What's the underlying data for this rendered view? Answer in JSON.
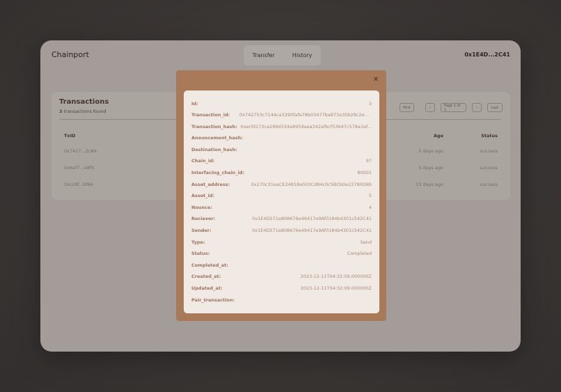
{
  "app": {
    "brand": "Chainport",
    "nav": [
      {
        "label": "Transfer"
      },
      {
        "label": "History"
      }
    ],
    "wallet": "0x1E4D...2C41"
  },
  "transactions": {
    "title": "Transactions",
    "count": "3",
    "count_suffix": " transactions found",
    "pager": {
      "first": "First",
      "prev": "‹",
      "page": "Page 1 of 1",
      "next": "›",
      "last": "Last"
    },
    "columns": {
      "txid": "TxID",
      "age": "Age",
      "status": "Status"
    },
    "rows": [
      {
        "txid": "0x7427...2c84",
        "age": "5 days ago",
        "status": "success"
      },
      {
        "txid": "0x6af7...e8f5",
        "age": "5 days ago",
        "status": "success"
      },
      {
        "txid": "0xcc8f...bf66",
        "age": "13 days ago",
        "status": "success"
      }
    ]
  },
  "modal": {
    "close_icon": "✕",
    "fields": [
      {
        "key": "Id:",
        "value": "3"
      },
      {
        "key": "Transaction_id:",
        "value": "0x742753c7144ca3290fafe78b03477ba873a35b29c2ea431e..."
      },
      {
        "key": "Transaction_hash:",
        "value": "0xecfd173ca299d334a9959aea342afbcf53647c578a3af..."
      },
      {
        "key": "Anouncement_hash:",
        "value": ""
      },
      {
        "key": "Destination_hash:",
        "value": ""
      },
      {
        "key": "Chain_id:",
        "value": "97"
      },
      {
        "key": "Interfacing_chain_id:",
        "value": "80001"
      },
      {
        "key": "Asset_address:",
        "value": "0x270c31eaCE24818e020Cd84c0c5BCb0e23780D6b"
      },
      {
        "key": "Asset_id:",
        "value": "5"
      },
      {
        "key": "Nounce:",
        "value": "4"
      },
      {
        "key": "Reciever:",
        "value": "0x1E4D571e808676e49417e9Af0184b4301c542C41"
      },
      {
        "key": "Sender:",
        "value": "0x1E4D571e808676e49417e9Af0184b4301c542C41"
      },
      {
        "key": "Type:",
        "value": "Send"
      },
      {
        "key": "Status:",
        "value": "Completed"
      },
      {
        "key": "Completed_at:",
        "value": ""
      },
      {
        "key": "Created_at:",
        "value": "2023-12-11T04:32:09.000000Z"
      },
      {
        "key": "Updated_at:",
        "value": "2023-12-11T04:32:09.000000Z"
      },
      {
        "key": "Pair_transaction:",
        "value": ""
      }
    ]
  }
}
